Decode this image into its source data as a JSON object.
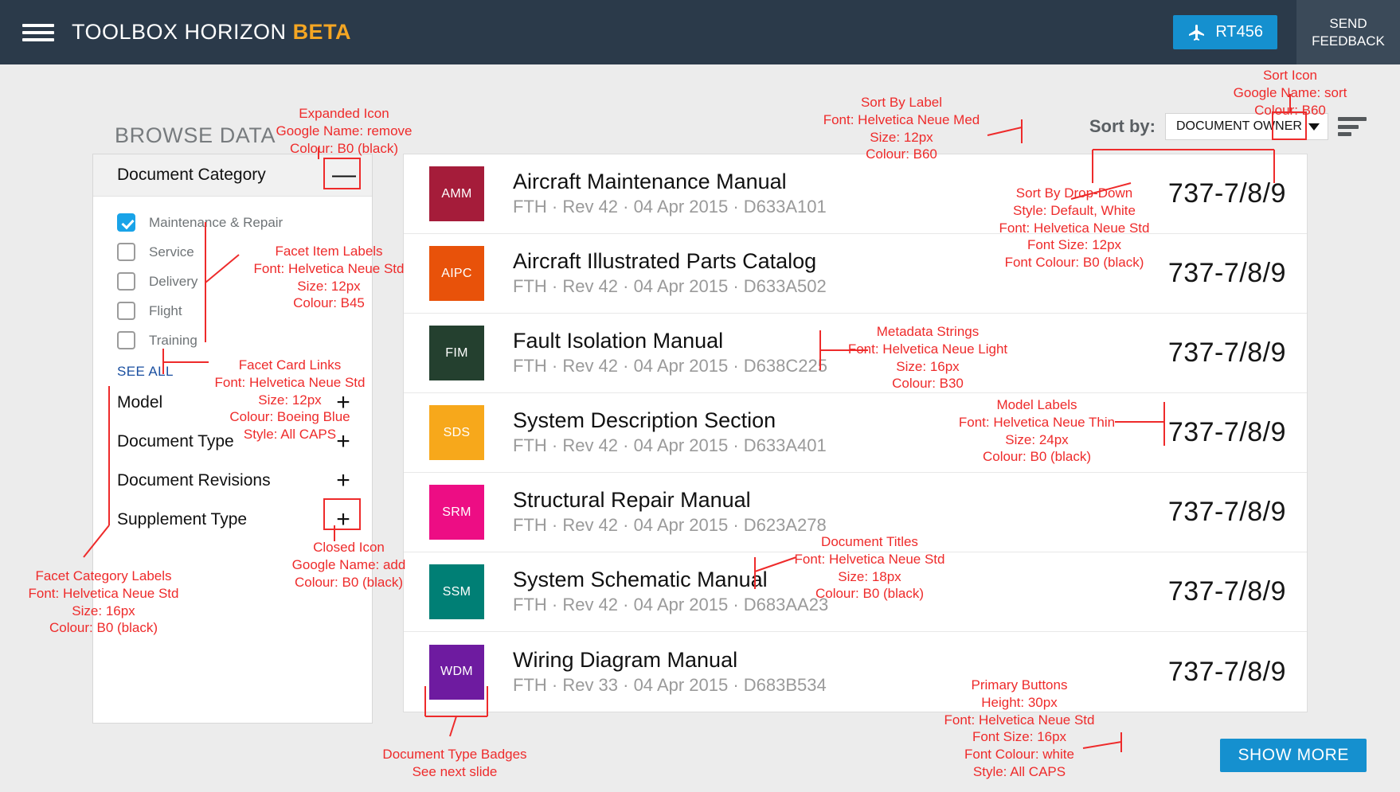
{
  "topnav": {
    "menu_icon": "hamburger-icon",
    "brand_main": "TOOLBOX HORIZON",
    "brand_beta": "BETA",
    "flight_button": {
      "icon": "airplane-icon",
      "label": "RT456"
    },
    "send_feedback_line1": "SEND",
    "send_feedback_line2": "FEEDBACK",
    "bg_color": "#2b3a4a",
    "accent_blue": "#1590cf",
    "beta_color": "#f5a623"
  },
  "sidebar": {
    "heading": "BROWSE DATA",
    "expanded_facet": {
      "title": "Document Category",
      "toggle_icon": "remove-icon",
      "toggle_glyph": "—",
      "items": [
        {
          "label": "Maintenance & Repair",
          "checked": true
        },
        {
          "label": "Service",
          "checked": false
        },
        {
          "label": "Delivery",
          "checked": false
        },
        {
          "label": "Flight",
          "checked": false
        },
        {
          "label": "Training",
          "checked": false
        }
      ],
      "see_all": "SEE ALL"
    },
    "collapsed_facets": [
      {
        "title": "Model",
        "toggle_icon": "add-icon",
        "toggle_glyph": "+"
      },
      {
        "title": "Document Type",
        "toggle_icon": "add-icon",
        "toggle_glyph": "+"
      },
      {
        "title": "Document Revisions",
        "toggle_icon": "add-icon",
        "toggle_glyph": "+"
      },
      {
        "title": "Supplement Type",
        "toggle_icon": "add-icon",
        "toggle_glyph": "+"
      }
    ]
  },
  "sortbar": {
    "label": "Sort by:",
    "selected": "DOCUMENT OWNER",
    "chevron_icon": "chevron-down-icon",
    "sort_icon": "sort-icon"
  },
  "results": {
    "rows": [
      {
        "badge": "AMM",
        "badge_color": "#a51c3a",
        "title": "Aircraft Maintenance Manual",
        "meta": "FTH · Rev 42 · 04 Apr 2015 · D633A101",
        "model": "737-7/8/9"
      },
      {
        "badge": "AIPC",
        "badge_color": "#e8520a",
        "title": "Aircraft Illustrated Parts Catalog",
        "meta": "FTH · Rev 42 · 04 Apr 2015 · D633A502",
        "model": "737-7/8/9"
      },
      {
        "badge": "FIM",
        "badge_color": "#24402f",
        "title": "Fault Isolation Manual",
        "meta": "FTH · Rev 42 · 04 Apr 2015 · D638C225",
        "model": "737-7/8/9"
      },
      {
        "badge": "SDS",
        "badge_color": "#f7a81b",
        "title": "System Description Section",
        "meta": "FTH · Rev 42 · 04 Apr 2015 · D633A401",
        "model": "737-7/8/9"
      },
      {
        "badge": "SRM",
        "badge_color": "#ed0d84",
        "title": "Structural Repair Manual",
        "meta": "FTH · Rev 42 · 04 Apr 2015 · D623A278",
        "model": "737-7/8/9"
      },
      {
        "badge": "SSM",
        "badge_color": "#007f75",
        "title": "System Schematic Manual",
        "meta": "FTH · Rev 42 · 04 Apr 2015 · D683AA23",
        "model": "737-7/8/9"
      },
      {
        "badge": "WDM",
        "badge_color": "#6e1ba0",
        "title": "Wiring Diagram Manual",
        "meta": "FTH · Rev 33 · 04 Apr 2015 · D683B534",
        "model": "737-7/8/9"
      }
    ],
    "show_more": "SHOW MORE"
  },
  "annotations": {
    "color": "#ee2b2b",
    "expanded_icon": "Expanded Icon\nGoogle Name: remove\nColour: B0 (black)",
    "facet_item_labels": "Facet Item Labels\nFont: Helvetica Neue Std\nSize: 12px\nColour: B45",
    "facet_card_links": "Facet Card Links\nFont: Helvetica Neue Std\nSize: 12px\nColour: Boeing Blue\nStyle: All CAPS",
    "closed_icon": "Closed Icon\nGoogle Name: add\nColour: B0 (black)",
    "facet_category_labels": "Facet Category Labels\nFont: Helvetica Neue Std\nSize: 16px\nColour: B0 (black)",
    "document_type_badges": "Document Type Badges\nSee next slide",
    "sort_by_label": "Sort By Label\nFont: Helvetica Neue Med\nSize: 12px\nColour: B60",
    "sort_icon": "Sort Icon\nGoogle Name: sort\nColour: B60",
    "sort_by_dropdown": "Sort By Drop-Down\nStyle: Default, White\nFont: Helvetica Neue Std\nFont Size: 12px\nFont Colour: B0 (black)",
    "metadata_strings": "Metadata Strings\nFont: Helvetica Neue Light\nSize: 16px\nColour: B30",
    "model_labels": "Model Labels\nFont: Helvetica Neue Thin\nSize: 24px\nColour: B0 (black)",
    "document_titles": "Document Titles\nFont: Helvetica Neue Std\nSize: 18px\nColour: B0 (black)",
    "primary_buttons": "Primary Buttons\nHeight: 30px\nFont: Helvetica Neue Std\nFont Size: 16px\nFont Colour: white\nStyle: All CAPS"
  }
}
